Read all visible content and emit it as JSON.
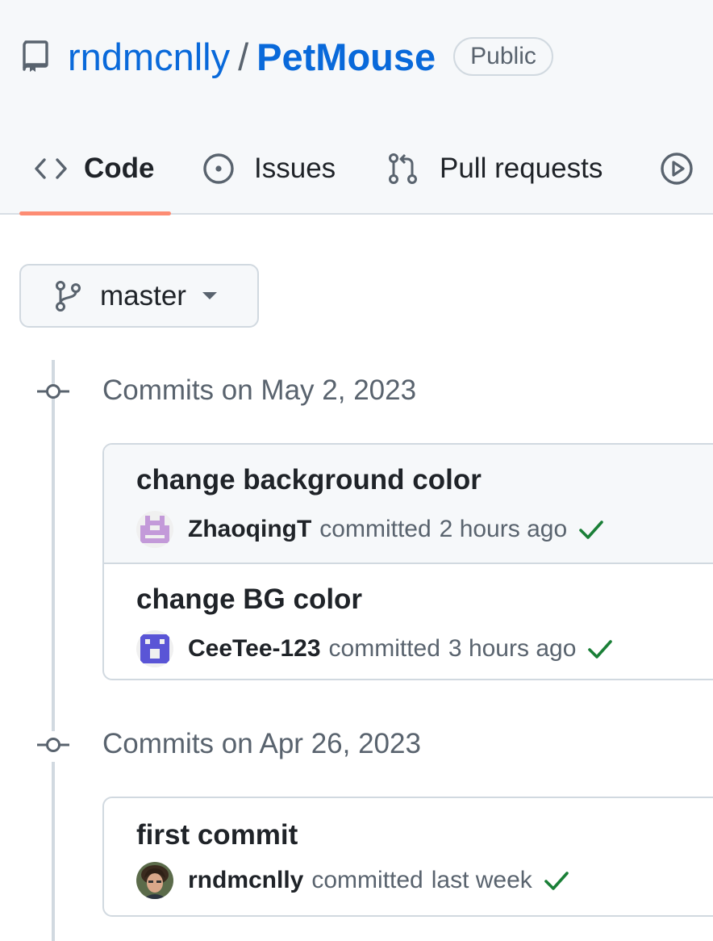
{
  "repo": {
    "owner": "rndmcnlly",
    "separator": "/",
    "name": "PetMouse",
    "visibility": "Public",
    "icon": "repo-icon"
  },
  "tabs": [
    {
      "label": "Code",
      "icon": "code-icon",
      "selected": true
    },
    {
      "label": "Issues",
      "icon": "issue-opened-icon",
      "selected": false
    },
    {
      "label": "Pull requests",
      "icon": "git-pull-request-icon",
      "selected": false
    },
    {
      "label": "",
      "icon": "play-icon",
      "selected": false
    }
  ],
  "branch": {
    "label": "master",
    "icon": "git-branch-icon"
  },
  "commit_groups": [
    {
      "title": "Commits on May 2, 2023",
      "commits": [
        {
          "message": "change background color",
          "author": "ZhaoqingT",
          "action": "committed",
          "time": "2 hours ago",
          "status": "success",
          "highlighted": true
        },
        {
          "message": "change BG color",
          "author": "CeeTee-123",
          "action": "committed",
          "time": "3 hours ago",
          "status": "success",
          "highlighted": false
        }
      ]
    },
    {
      "title": "Commits on Apr 26, 2023",
      "commits": [
        {
          "message": "first commit",
          "author": "rndmcnlly",
          "action": "committed",
          "time": "last week",
          "status": "success",
          "highlighted": false
        }
      ]
    }
  ],
  "colors": {
    "link": "#0969da",
    "muted": "#59636e",
    "tab_underline": "#fd8c73",
    "success": "#1a7f37",
    "avatar_zhaoqingt": "#c39ad9",
    "avatar_ceetee": "#5a55d6"
  }
}
